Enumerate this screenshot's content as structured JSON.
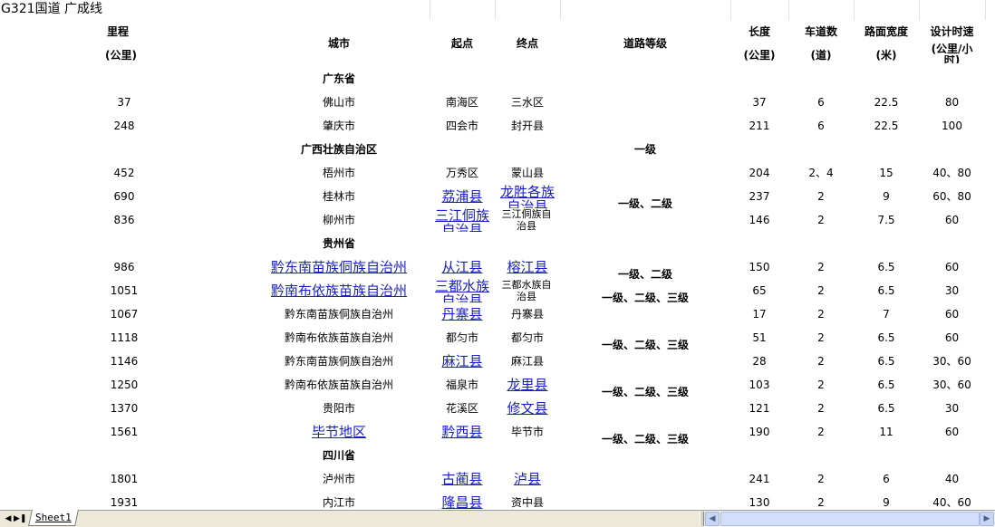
{
  "title": "G321国道 广成线",
  "headers": {
    "mileage": [
      "里程",
      "(公里)"
    ],
    "city": "城市",
    "start": "起点",
    "end": "终点",
    "grade": "道路等级",
    "length": [
      "长度",
      "(公里)"
    ],
    "lanes": [
      "车道数",
      "(道)"
    ],
    "width": [
      "路面宽度",
      "(米)"
    ],
    "speed": [
      "设计时速",
      "(公里/小",
      "时)"
    ]
  },
  "provinces": [
    "广东省",
    "广西壮族自治区",
    "贵州省",
    "四川省"
  ],
  "rows": [
    {
      "km": "37",
      "city": "佛山市",
      "start": "南海区",
      "end": "三水区",
      "len": "37",
      "lanes": "6",
      "width": "22.5",
      "speed": "80"
    },
    {
      "km": "248",
      "city": "肇庆市",
      "start": "四会市",
      "end": "封开县",
      "len": "211",
      "lanes": "6",
      "width": "22.5",
      "speed": "100"
    },
    {
      "km": "452",
      "city": "梧州市",
      "start": "万秀区",
      "end": "蒙山县",
      "len": "204",
      "lanes": "2、4",
      "width": "15",
      "speed": "40、80"
    },
    {
      "km": "690",
      "city": "桂林市",
      "start": "荔浦县",
      "end": "龙胜各族",
      "end2": "自治县",
      "len": "237",
      "lanes": "2",
      "width": "9",
      "speed": "60、80"
    },
    {
      "km": "836",
      "city": "柳州市",
      "start": "三江侗族",
      "start2": "自治县",
      "end": "三江侗族自",
      "end2": "治县",
      "len": "146",
      "lanes": "2",
      "width": "7.5",
      "speed": "60"
    },
    {
      "km": "986",
      "city": "黔东南苗族侗族自治州",
      "start": "从江县",
      "end": "榕江县",
      "len": "150",
      "lanes": "2",
      "width": "6.5",
      "speed": "60"
    },
    {
      "km": "1051",
      "city": "黔南布依族苗族自治州",
      "start": "三都水族",
      "start2": "自治县",
      "end": "三都水族自",
      "end2": "治县",
      "len": "65",
      "lanes": "2",
      "width": "6.5",
      "speed": "30"
    },
    {
      "km": "1067",
      "city": "黔东南苗族侗族自治州",
      "start": "丹寨县",
      "end": "丹寨县",
      "len": "17",
      "lanes": "2",
      "width": "7",
      "speed": "60"
    },
    {
      "km": "1118",
      "city": "黔南布依族苗族自治州",
      "start": "都匀市",
      "end": "都匀市",
      "len": "51",
      "lanes": "2",
      "width": "6.5",
      "speed": "60"
    },
    {
      "km": "1146",
      "city": "黔东南苗族侗族自治州",
      "start": "麻江县",
      "end": "麻江县",
      "len": "28",
      "lanes": "2",
      "width": "6.5",
      "speed": "30、60"
    },
    {
      "km": "1250",
      "city": "黔南布依族苗族自治州",
      "start": "福泉市",
      "end": "龙里县",
      "len": "103",
      "lanes": "2",
      "width": "6.5",
      "speed": "30、60"
    },
    {
      "km": "1370",
      "city": "贵阳市",
      "start": "花溪区",
      "end": "修文县",
      "len": "121",
      "lanes": "2",
      "width": "6.5",
      "speed": "30"
    },
    {
      "km": "1561",
      "city": "毕节地区",
      "start": "黔西县",
      "end": "毕节市",
      "len": "190",
      "lanes": "2",
      "width": "11",
      "speed": "60"
    },
    {
      "km": "1801",
      "city": "泸州市",
      "start": "古蔺县",
      "end": "泸县",
      "len": "241",
      "lanes": "2",
      "width": "6",
      "speed": "40"
    },
    {
      "km": "1931",
      "city": "内江市",
      "start": "隆昌县",
      "end": "资中县",
      "len": "130",
      "lanes": "2",
      "width": "9",
      "speed": "40、60"
    }
  ],
  "grades": [
    "一级",
    "一级、二级",
    "一级、二级",
    "一级、二级、三级",
    "一级、二级、三级",
    "一级、二级、三级",
    "一级、二级、三级"
  ],
  "sheet_tab": "Sheet1",
  "colors": {
    "link": "#1a20c8",
    "tabbar": "#ece9d8",
    "scroll": "#c8d6f5"
  }
}
